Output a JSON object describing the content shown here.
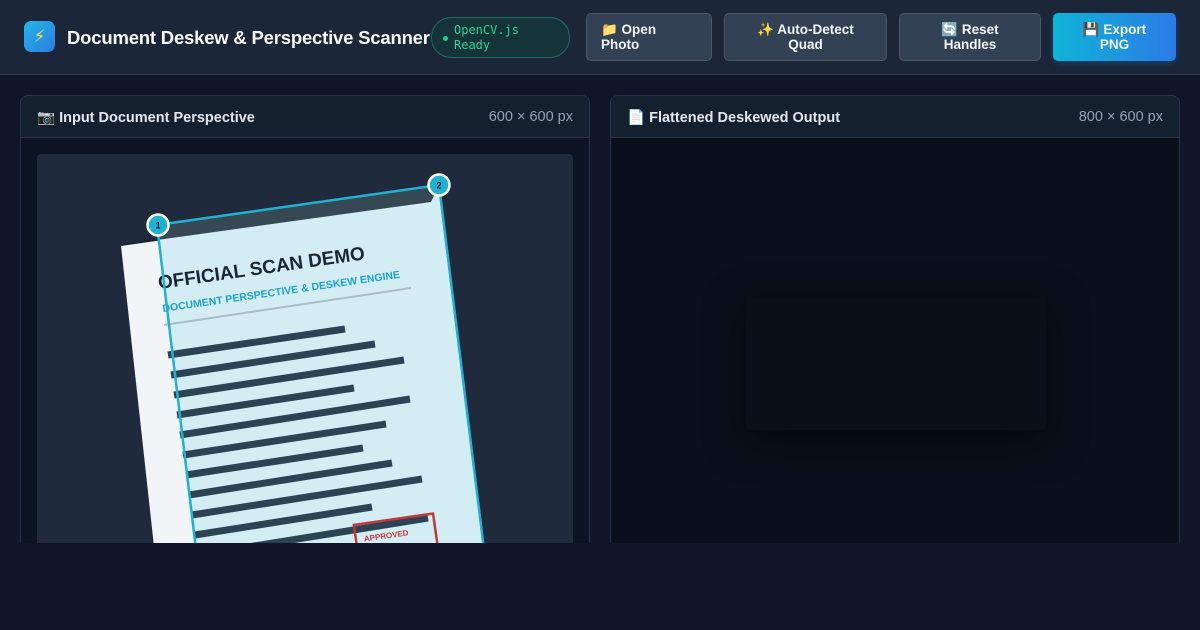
{
  "app": {
    "title": "Document Deskew & Perspective Scanner",
    "logo_icon": "lightning-icon",
    "logo_glyph": "⚡",
    "status_line1": "OpenCV.js",
    "status_line2": "Ready"
  },
  "toolbar": {
    "open_line1": "📁 Open",
    "open_line2": "Photo",
    "auto_line1": "✨ Auto-Detect",
    "auto_line2": "Quad",
    "reset_line1": "🔄 Reset",
    "reset_line2": "Handles",
    "export_line1": "💾 Export",
    "export_line2": "PNG"
  },
  "input_panel": {
    "title": "📷 Input Document Perspective",
    "dims": "600 × 600 px",
    "document": {
      "heading": "OFFICIAL SCAN DEMO",
      "subheading": "DOCUMENT PERSPECTIVE & DESKEW ENGINE",
      "stamp": "APPROVED"
    },
    "handles": [
      "1",
      "2"
    ]
  },
  "output_panel": {
    "title": "📄 Flattened Deskewed Output",
    "dims": "800 × 600 px"
  },
  "colors": {
    "accent": "#22b8d8",
    "stamp": "#c0393b",
    "status_green": "#2fcf95"
  }
}
